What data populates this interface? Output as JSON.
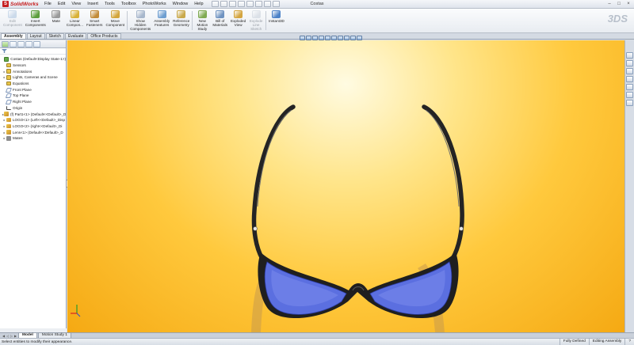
{
  "app": {
    "logo_text": "SolidWorks",
    "window_title": "Costas",
    "brand_mark": "3DS"
  },
  "menu": [
    "File",
    "Edit",
    "View",
    "Insert",
    "Tools",
    "Toolbox",
    "PhotoWorks",
    "Window",
    "Help"
  ],
  "commands": [
    {
      "label": "Edit\nComponent",
      "disabled": true,
      "color": "#8fb0d6"
    },
    {
      "label": "Insert\nComponents",
      "disabled": false,
      "color": "#5c9e3c"
    },
    {
      "label": "Mate",
      "disabled": false,
      "color": "#9a9a9a"
    },
    {
      "label": "Linear\nCompon...",
      "disabled": false,
      "color": "#d8b137"
    },
    {
      "label": "Smart\nFasteners",
      "disabled": false,
      "color": "#c28b39"
    },
    {
      "label": "Move\nComponent",
      "disabled": false,
      "color": "#d3a53b"
    },
    {
      "label": "Show\nHidden\nComponents",
      "disabled": false,
      "color": "#a7b7cc"
    },
    {
      "label": "Assembly\nFeatures",
      "disabled": false,
      "color": "#6e9ed0"
    },
    {
      "label": "Reference\nGeometry",
      "disabled": false,
      "color": "#c9a94b"
    },
    {
      "label": "New\nMotion\nStudy",
      "disabled": false,
      "color": "#7faa52"
    },
    {
      "label": "Bill of\nMaterials",
      "disabled": false,
      "color": "#6f93c1"
    },
    {
      "label": "Exploded\nView",
      "disabled": false,
      "color": "#d4a540"
    },
    {
      "label": "Explode\nLine\nSketch",
      "disabled": true,
      "color": "#b8c2cf"
    },
    {
      "label": "Instant3D",
      "disabled": false,
      "color": "#4c82c8"
    }
  ],
  "tabs": [
    "Assembly",
    "Layout",
    "Sketch",
    "Evaluate",
    "Office Products"
  ],
  "active_tab": "Assembly",
  "tree": [
    {
      "label": "Costas  (Default<Display State-1>)",
      "icon": "green",
      "expander": "",
      "indent": 0
    },
    {
      "label": "Sensors",
      "icon": "yellow",
      "expander": "",
      "indent": 1
    },
    {
      "label": "Annotations",
      "icon": "yellow",
      "expander": "▸",
      "indent": 1
    },
    {
      "label": "Lights, Cameras and Scene",
      "icon": "yellow",
      "expander": "▸",
      "indent": 1
    },
    {
      "label": "Equations",
      "icon": "yellow",
      "expander": "",
      "indent": 1
    },
    {
      "label": "Front Plane",
      "icon": "plane",
      "expander": "",
      "indent": 1
    },
    {
      "label": "Top Plane",
      "icon": "plane",
      "expander": "",
      "indent": 1
    },
    {
      "label": "Right Plane",
      "icon": "plane",
      "expander": "",
      "indent": 1
    },
    {
      "label": "Origin",
      "icon": "origin",
      "expander": "",
      "indent": 1
    },
    {
      "label": "(f) Part1<1> (Default<<Default>_D",
      "icon": "part",
      "expander": "▸",
      "indent": 1
    },
    {
      "label": "LOGO<1> (Left<<Default>_Disp",
      "icon": "part",
      "expander": "▸",
      "indent": 1
    },
    {
      "label": "LOGO<2> (right<<Default>_Di",
      "icon": "part",
      "expander": "▸",
      "indent": 1
    },
    {
      "label": "Lens<1> (Default<<Default>_D",
      "icon": "part",
      "expander": "▸",
      "indent": 1
    },
    {
      "label": "Mates",
      "icon": "mates",
      "expander": "▸",
      "indent": 1
    }
  ],
  "model_tabs": [
    "Model",
    "Motion Study 1"
  ],
  "active_model_tab": "Model",
  "status": {
    "message": "Select entities to modify their appearance.",
    "state": "Fully Defined",
    "mode": "Editing Assembly"
  },
  "colors": {
    "viewport_top": "#fffbe2",
    "viewport_bottom": "#f5a913",
    "frame": "#2a2a2a",
    "lens": "#5b6fe0"
  }
}
